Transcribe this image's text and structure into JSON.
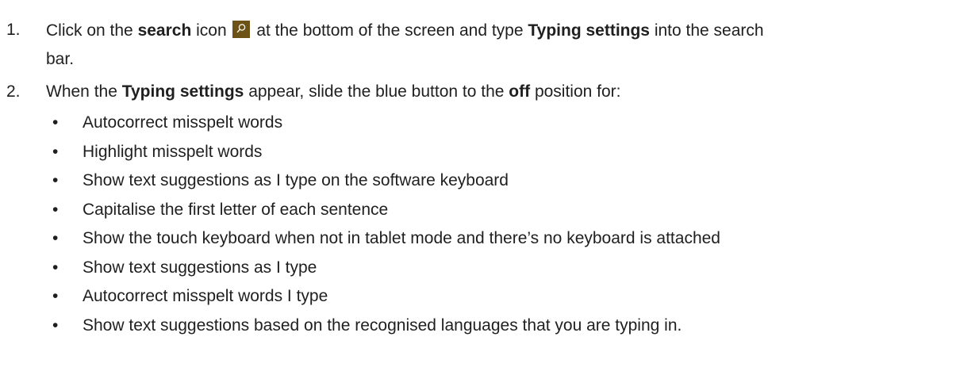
{
  "steps": [
    {
      "number": "1.",
      "before_bold1": "Click on the ",
      "bold1": "search",
      "after_bold1": " icon ",
      "icon": "search-icon",
      "after_icon": " at the bottom of the screen and type ",
      "bold2": "Typing settings",
      "after_bold2": " into the search",
      "continuation": "bar."
    },
    {
      "number": "2.",
      "before_bold1": "When the ",
      "bold1": "Typing settings",
      "middle": " appear, slide the blue button to the ",
      "bold2": "off",
      "after_bold2": " position for:"
    }
  ],
  "bullets": [
    "Autocorrect misspelt words",
    "Highlight misspelt words",
    "Show text suggestions as I type on the software keyboard",
    "Capitalise the first letter of each sentence",
    "Show the touch keyboard when not in tablet mode and there’s no keyboard is attached",
    "Show text suggestions as I type",
    "Autocorrect misspelt words I type",
    "Show text suggestions based on the recognised languages that you are typing in."
  ],
  "bullet_glyph": "•",
  "colors": {
    "search_icon_bg": "#6d5217",
    "text": "#1f1f1f"
  }
}
